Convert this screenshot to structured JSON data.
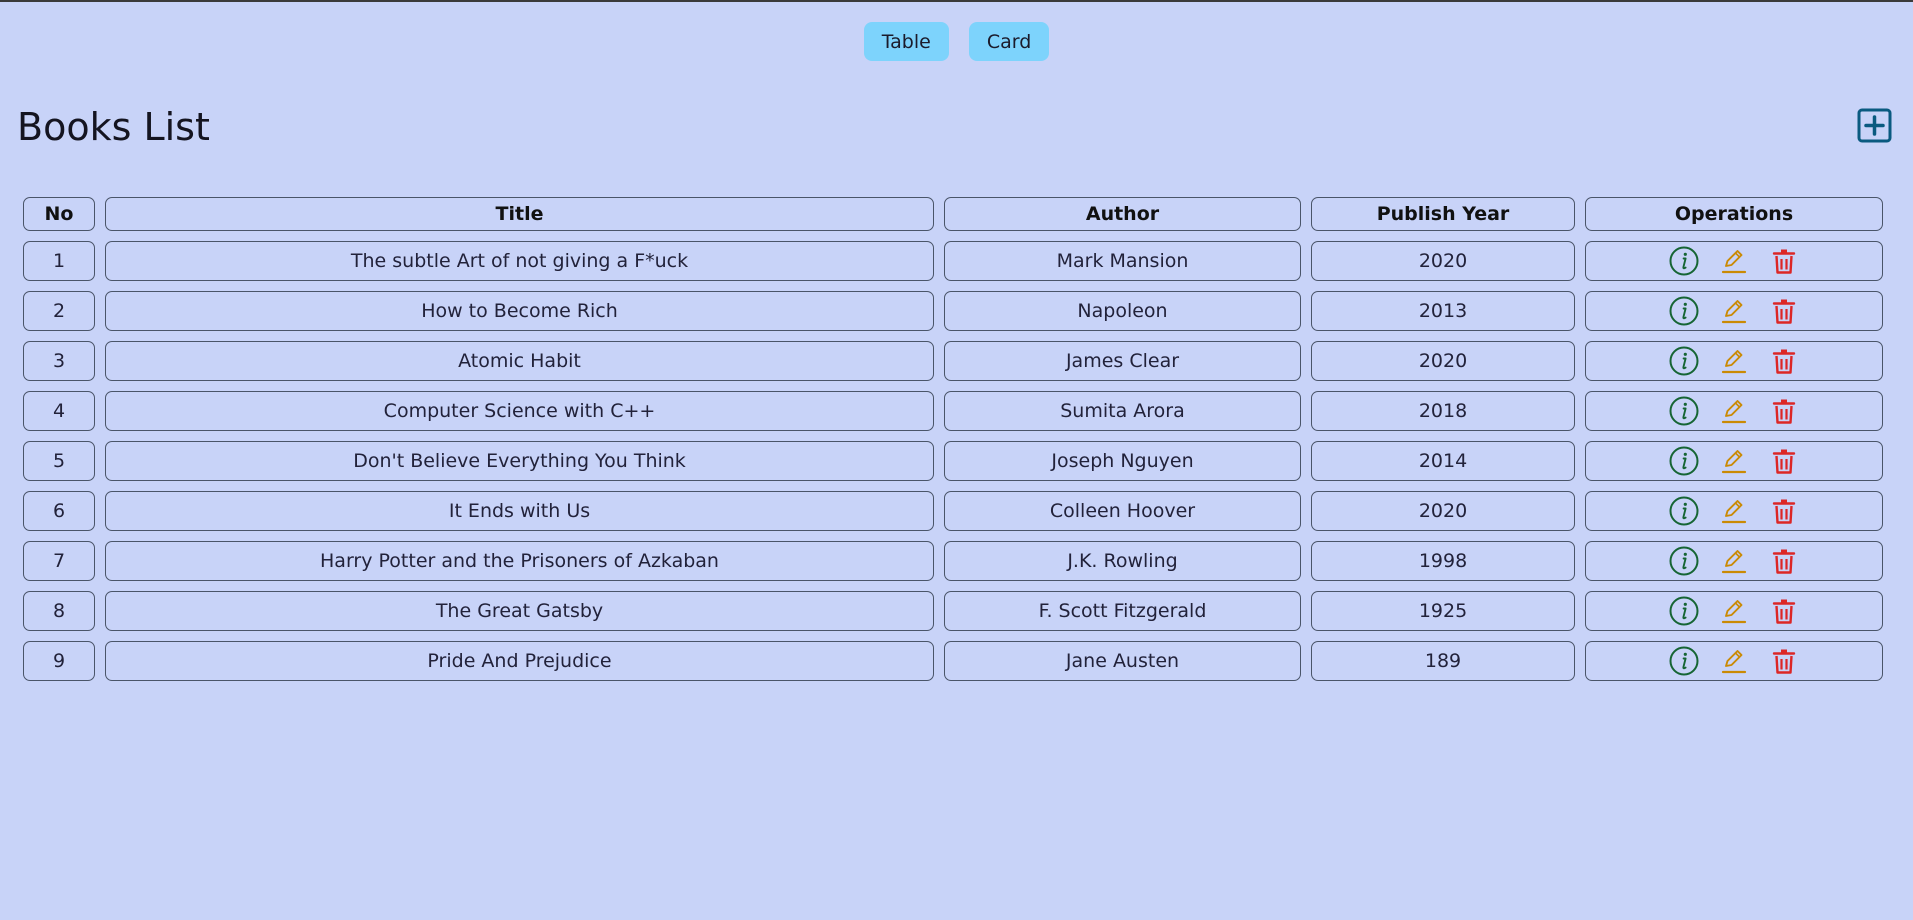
{
  "view_toggle": {
    "table_label": "Table",
    "card_label": "Card"
  },
  "page_title": "Books List",
  "table": {
    "headers": {
      "no": "No",
      "title": "Title",
      "author": "Author",
      "publish_year": "Publish Year",
      "operations": "Operations"
    },
    "rows": [
      {
        "no": "1",
        "title": "The subtle Art of not giving a F*uck",
        "author": "Mark Mansion",
        "year": "2020"
      },
      {
        "no": "2",
        "title": "How to Become Rich",
        "author": "Napoleon",
        "year": "2013"
      },
      {
        "no": "3",
        "title": "Atomic Habit",
        "author": "James Clear",
        "year": "2020"
      },
      {
        "no": "4",
        "title": "Computer Science with C++",
        "author": "Sumita Arora",
        "year": "2018"
      },
      {
        "no": "5",
        "title": "Don't Believe Everything You Think",
        "author": "Joseph Nguyen",
        "year": "2014"
      },
      {
        "no": "6",
        "title": "It Ends with Us",
        "author": "Colleen Hoover",
        "year": "2020"
      },
      {
        "no": "7",
        "title": "Harry Potter and the Prisoners of Azkaban",
        "author": "J.K. Rowling",
        "year": "1998"
      },
      {
        "no": "8",
        "title": "The Great Gatsby",
        "author": "F. Scott Fitzgerald",
        "year": "1925"
      },
      {
        "no": "9",
        "title": "Pride And Prejudice",
        "author": "Jane Austen",
        "year": "189"
      }
    ]
  },
  "icons": {
    "add": "plus-square-icon",
    "info": "info-circle-icon",
    "edit": "pencil-icon",
    "delete": "trash-icon"
  },
  "colors": {
    "background": "#c8d3f8",
    "toggle_button": "#7dd3fc",
    "add_icon": "#0a5a80",
    "info_icon": "#166534",
    "edit_icon": "#ca8a04",
    "delete_icon": "#dc2626"
  }
}
